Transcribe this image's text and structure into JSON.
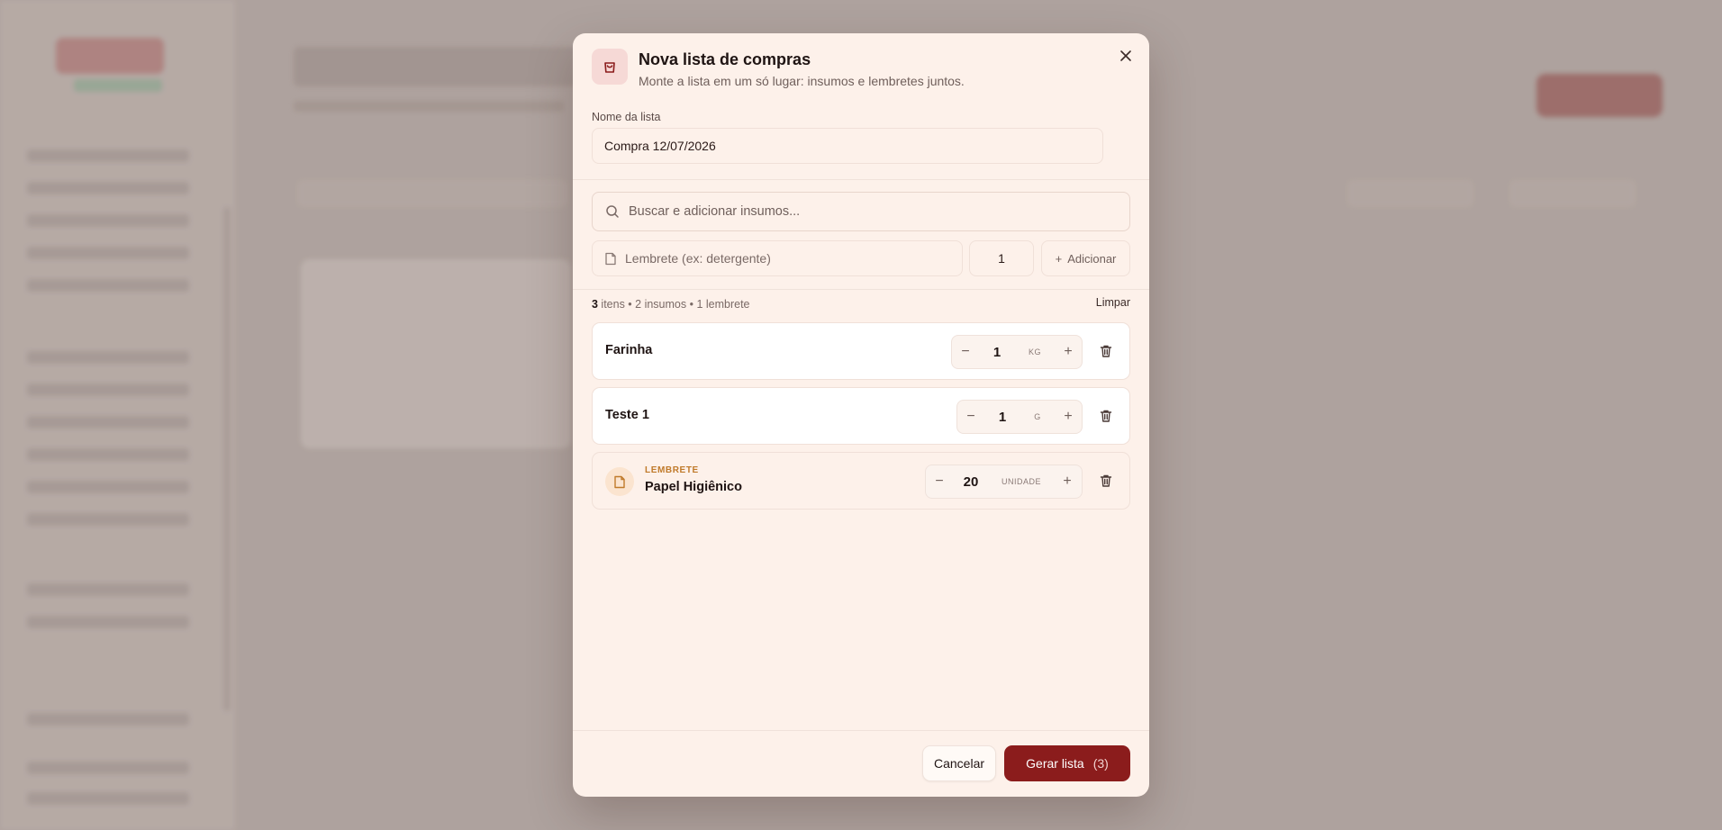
{
  "modal": {
    "title": "Nova lista de compras",
    "subtitle": "Monte a lista em um só lugar: insumos e lembretes juntos.",
    "close_label": "×"
  },
  "list_name": {
    "label": "Nome da lista",
    "value": "Compra 12/07/2026"
  },
  "search": {
    "placeholder": "Buscar e adicionar insumos..."
  },
  "reminder": {
    "placeholder": "Lembrete (ex: detergente)",
    "quantity": "1",
    "add_label": "Adicionar"
  },
  "summary": {
    "count": "3",
    "text": " itens • 2 insumos • 1 lembrete",
    "clear_label": "Limpar"
  },
  "items": [
    {
      "name": "Farinha",
      "quantity": "1",
      "unit": "KG"
    },
    {
      "name": "Teste 1",
      "quantity": "1",
      "unit": "G"
    },
    {
      "tag": "LEMBRETE",
      "name": "Papel Higiênico",
      "quantity": "20",
      "unit": "UNIDADE"
    }
  ],
  "stepper": {
    "minus": "−",
    "plus": "+"
  },
  "footer": {
    "cancel_label": "Cancelar",
    "submit_label": "Gerar lista",
    "submit_count": "(3)"
  },
  "colors": {
    "primary": "#8b1c1c",
    "modal_bg": "#fdf1ea",
    "reminder_tag": "#c07a2a"
  }
}
